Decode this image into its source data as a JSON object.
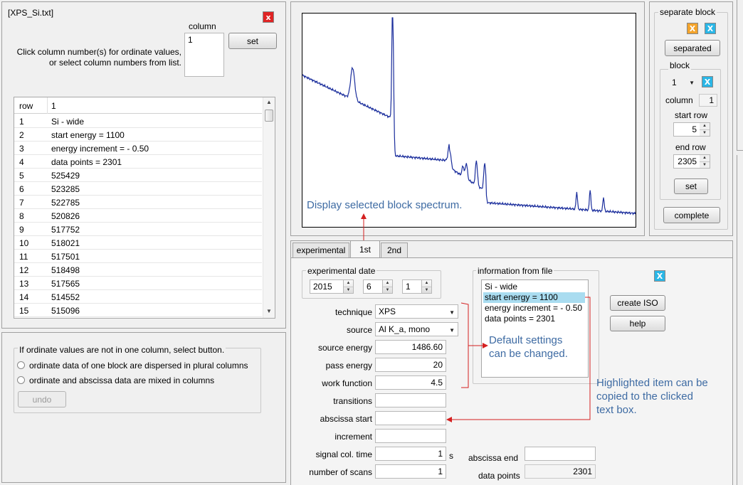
{
  "left_top": {
    "title": "[XPS_Si.txt]",
    "close_icon": "x",
    "column_label": "column",
    "column_list": [
      "1"
    ],
    "set_button": "set",
    "instruction_line1": "Click column number(s) for ordinate values,",
    "instruction_line2": "or select column numbers from list.",
    "table": {
      "headers": [
        "row",
        "1"
      ],
      "rows": [
        [
          "1",
          "Si - wide"
        ],
        [
          "2",
          "start energy = 1100"
        ],
        [
          "3",
          "energy increment = - 0.50"
        ],
        [
          "4",
          "data points = 2301"
        ],
        [
          "5",
          "525429"
        ],
        [
          "6",
          "523285"
        ],
        [
          "7",
          "522785"
        ],
        [
          "8",
          "520826"
        ],
        [
          "9",
          "517752"
        ],
        [
          "10",
          "518021"
        ],
        [
          "11",
          "517501"
        ],
        [
          "12",
          "518498"
        ],
        [
          "13",
          "517565"
        ],
        [
          "14",
          "514552"
        ],
        [
          "15",
          "515096"
        ]
      ]
    }
  },
  "left_bottom": {
    "group_title": "If ordinate values are not in one column, select button.",
    "radio1": "ordinate data of one block are dispersed in plural columns",
    "radio2": "ordinate and abscissa data are mixed in columns",
    "undo_button": "undo"
  },
  "chart_note": "Display selected block spectrum.",
  "right_panel": {
    "separate_block_title": "separate block",
    "icon_x_orange": "X",
    "icon_x_blue": "X",
    "separated_button": "separated",
    "block_title": "block",
    "block_value": "1",
    "column_label": "column",
    "column_value": "1",
    "start_row_label": "start row",
    "start_row_value": "5",
    "end_row_label": "end row",
    "end_row_value": "2305",
    "set_button": "set",
    "complete_button": "complete"
  },
  "tabs": [
    "experimental",
    "1st",
    "2nd"
  ],
  "experimental": {
    "date_label": "experimental date",
    "year": "2015",
    "month": "6",
    "day": "1",
    "technique_label": "technique",
    "technique_value": "XPS",
    "source_label": "source",
    "source_value": "Al K_a, mono",
    "source_energy_label": "source energy",
    "source_energy_value": "1486.60",
    "pass_energy_label": "pass energy",
    "pass_energy_value": "20",
    "work_function_label": "work function",
    "work_function_value": "4.5",
    "transitions_label": "transitions",
    "transitions_value": "",
    "abscissa_start_label": "abscissa start",
    "abscissa_start_value": "",
    "increment_label": "increment",
    "increment_value": "",
    "signal_time_label": "signal col. time",
    "signal_time_value": "1",
    "signal_time_unit": "s",
    "scans_label": "number of scans",
    "scans_value": "1",
    "abscissa_end_label": "abscissa end",
    "abscissa_end_value": "",
    "data_points_label": "data points",
    "data_points_value": "2301",
    "info_title": "information from file",
    "info_items": [
      "Si - wide",
      "start energy = 1100",
      "energy increment = - 0.50",
      "data points = 2301"
    ],
    "info_selected_index": 1,
    "info_close_icon": "X",
    "create_iso_button": "create ISO",
    "help_button": "help",
    "note_default_1": "Default settings",
    "note_default_2": "can be changed.",
    "note_highlight_1": "Highlighted item can be",
    "note_highlight_2": "copied to the clicked",
    "note_highlight_3": "text box."
  },
  "colors": {
    "spectrum": "#1a2d9c",
    "annotation_text": "#3e6ba3",
    "annotation_arrow": "#d42020",
    "close_red": "#e02424",
    "icon_orange": "#f3a32a",
    "icon_blue": "#2ab6e6",
    "selection": "#a9dcf0"
  }
}
